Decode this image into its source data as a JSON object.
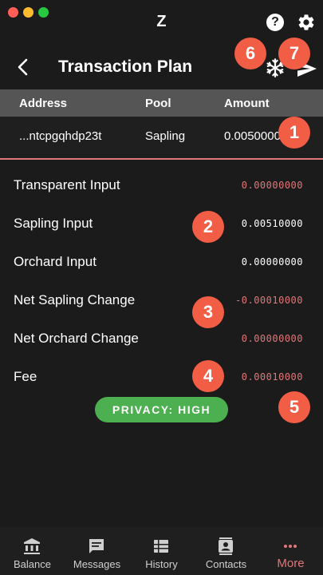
{
  "window": {
    "title": "Z"
  },
  "header": {
    "title": "Transaction Plan"
  },
  "table": {
    "columns": [
      "Address",
      "Pool",
      "Amount"
    ],
    "rows": [
      {
        "address": "...ntcpgqhdp23t",
        "pool": "Sapling",
        "amount": "0.00500000"
      }
    ]
  },
  "summary": [
    {
      "label": "Transparent Input",
      "value": "0.00000000",
      "color": "#e0787a"
    },
    {
      "label": "Sapling Input",
      "value": "0.00510000",
      "color": "#ffffff"
    },
    {
      "label": "Orchard Input",
      "value": "0.00000000",
      "color": "#ffffff"
    },
    {
      "label": "Net Sapling Change",
      "value": "-0.00010000",
      "color": "#e0787a"
    },
    {
      "label": "Net Orchard Change",
      "value": "0.00000000",
      "color": "#e0787a"
    },
    {
      "label": "Fee",
      "value": "0.00010000",
      "color": "#e0787a"
    }
  ],
  "privacy": {
    "label": "PRIVACY: HIGH",
    "color": "#4caf50"
  },
  "badges": [
    "1",
    "2",
    "3",
    "4",
    "5",
    "6",
    "7"
  ],
  "nav": {
    "items": [
      {
        "label": "Balance",
        "icon": "bank-icon"
      },
      {
        "label": "Messages",
        "icon": "message-icon"
      },
      {
        "label": "History",
        "icon": "history-icon"
      },
      {
        "label": "Contacts",
        "icon": "contacts-icon"
      },
      {
        "label": "More",
        "icon": "more-icon",
        "active": true
      }
    ]
  },
  "colors": {
    "accent": "#e0787a",
    "badge": "#f25d45",
    "header_bg": "#555555",
    "background": "#1b1b1b"
  }
}
